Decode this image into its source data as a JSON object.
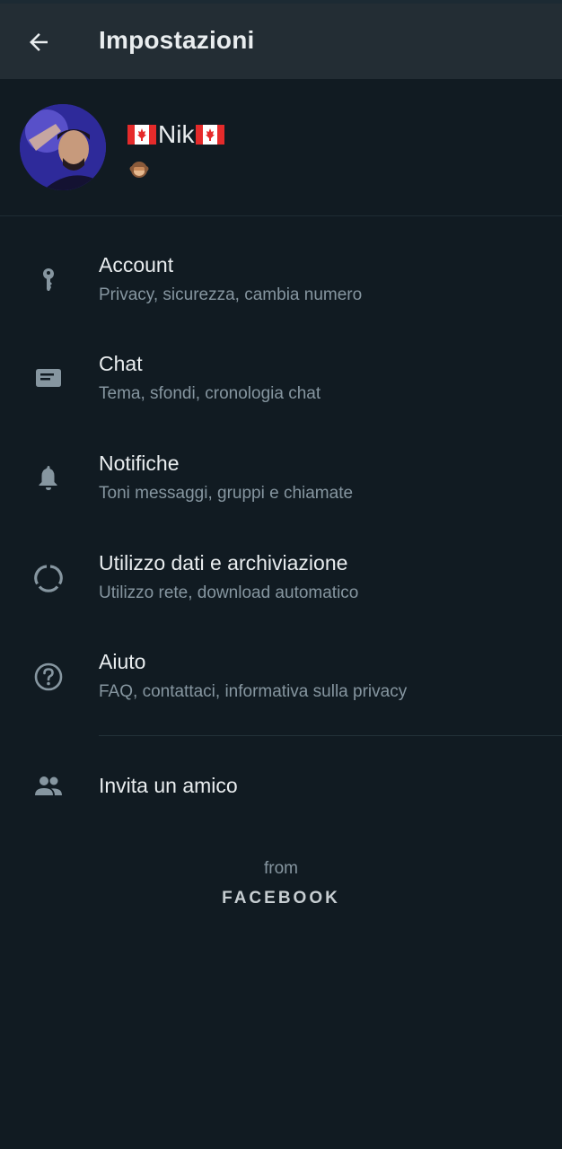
{
  "app_bar": {
    "title": "Impostazioni"
  },
  "profile": {
    "name": "Nik",
    "status_icon": "monkey-emoji"
  },
  "menu": [
    {
      "icon": "key-icon",
      "title": "Account",
      "subtitle": "Privacy, sicurezza, cambia numero"
    },
    {
      "icon": "chat-icon",
      "title": "Chat",
      "subtitle": "Tema, sfondi, cronologia chat"
    },
    {
      "icon": "bell-icon",
      "title": "Notifiche",
      "subtitle": "Toni messaggi, gruppi e chiamate"
    },
    {
      "icon": "data-usage-icon",
      "title": "Utilizzo dati e archiviazione",
      "subtitle": "Utilizzo rete, download automatico"
    },
    {
      "icon": "help-icon",
      "title": "Aiuto",
      "subtitle": "FAQ, contattaci, informativa sulla privacy"
    }
  ],
  "invite": {
    "icon": "people-icon",
    "label": "Invita un amico"
  },
  "footer": {
    "from": "from",
    "brand": "FACEBOOK"
  },
  "colors": {
    "background": "#111b22",
    "app_bar": "#232d34",
    "icon": "#8696a0",
    "primary_text": "#e9edef",
    "secondary_text": "#8696a0"
  }
}
